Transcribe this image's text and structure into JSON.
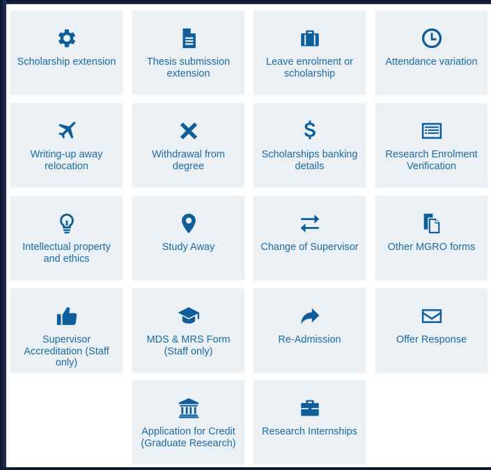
{
  "tiles": [
    {
      "label": "Scholarship extension",
      "icon": "gear-icon"
    },
    {
      "label": "Thesis submission extension",
      "icon": "document-icon"
    },
    {
      "label": "Leave enrolment or scholarship",
      "icon": "briefcase-icon"
    },
    {
      "label": "Attendance variation",
      "icon": "clock-icon"
    },
    {
      "label": "Writing-up away relocation",
      "icon": "airplane-icon"
    },
    {
      "label": "Withdrawal from degree",
      "icon": "close-icon"
    },
    {
      "label": "Scholarships banking details",
      "icon": "dollar-icon"
    },
    {
      "label": "Research Enrolment Verification",
      "icon": "list-card-icon"
    },
    {
      "label": "Intellectual property and ethics",
      "icon": "lightbulb-icon"
    },
    {
      "label": "Study Away",
      "icon": "map-pin-icon"
    },
    {
      "label": "Change of Supervisor",
      "icon": "swap-arrows-icon"
    },
    {
      "label": "Other MGRO forms",
      "icon": "copy-documents-icon"
    },
    {
      "label": "Supervisor Accreditation (Staff only)",
      "icon": "thumbs-up-icon"
    },
    {
      "label": "MDS & MRS Form (Staff only)",
      "icon": "graduation-cap-icon"
    },
    {
      "label": "Re-Admission",
      "icon": "share-arrow-icon"
    },
    {
      "label": "Offer Response",
      "icon": "envelope-icon"
    },
    {
      "label": "Application for Credit (Graduate Research)",
      "icon": "institution-icon"
    },
    {
      "label": "Research Internships",
      "icon": "toolbox-icon"
    }
  ],
  "colors": {
    "tile_bg": "#eaf0f3",
    "icon": "#0f5e99",
    "label": "#1c6aa7"
  }
}
